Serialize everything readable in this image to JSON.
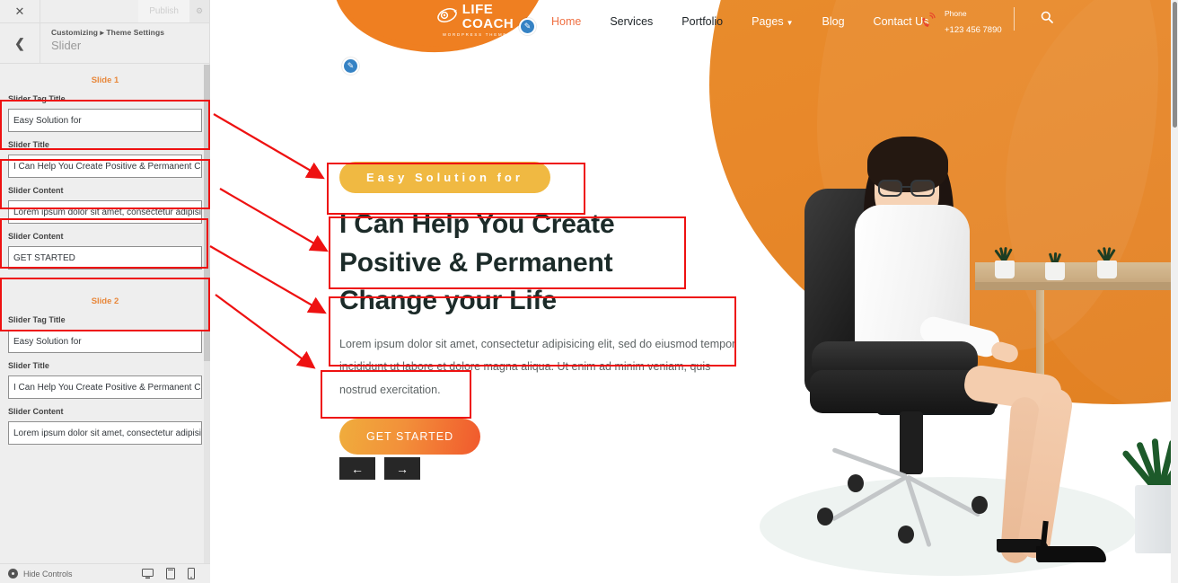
{
  "customizer": {
    "close_icon": "close-icon",
    "publish_label": "Publish",
    "publish_gear_icon": "gear-icon",
    "back_icon": "chevron-left-icon",
    "breadcrumb": "Customizing ▸ Theme Settings",
    "panel_title": "Slider",
    "footer": {
      "hide_controls_label": "Hide Controls",
      "desktop_icon": "desktop-preview-icon",
      "tablet_icon": "tablet-preview-icon",
      "mobile_icon": "mobile-preview-icon"
    },
    "slides": [
      {
        "heading": "Slide 1",
        "fields": [
          {
            "label": "Slider Tag Title",
            "value": "Easy Solution for"
          },
          {
            "label": "Slider Title",
            "value": "I Can Help You Create Positive & Permanent Change your"
          },
          {
            "label": "Slider Content",
            "value": "Lorem ipsum dolor sit amet, consectetur adipisicing elit,"
          },
          {
            "label": "Slider Content",
            "value": "GET STARTED"
          }
        ]
      },
      {
        "heading": "Slide 2",
        "fields": [
          {
            "label": "Slider Tag Title",
            "value": "Easy Solution for"
          },
          {
            "label": "Slider Title",
            "value": "I Can Help You Create Positive & Permanent Change your"
          },
          {
            "label": "Slider Content",
            "value": "Lorem ipsum dolor sit amet, consectetur adipisicing elit,"
          }
        ]
      }
    ]
  },
  "preview": {
    "logo": {
      "line1": "LIFE",
      "line2": "COACH",
      "tagline": "WORDPRESS THEME",
      "icon": "rocket-orbit-icon"
    },
    "nav": [
      {
        "label": "Home",
        "active": true
      },
      {
        "label": "Services",
        "active": false
      },
      {
        "label": "Portfolio",
        "active": false
      },
      {
        "label": "Pages",
        "active": false,
        "has_caret": true
      },
      {
        "label": "Blog",
        "active": false
      },
      {
        "label": "Contact Us",
        "active": false
      }
    ],
    "phone": {
      "icon": "phone-ringing-icon",
      "label": "Phone",
      "number": "+123 456 7890"
    },
    "search_icon": "search-icon",
    "hero": {
      "tag": "Easy Solution for",
      "title": "I Can Help You Create Positive & Permanent Change your Life",
      "paragraph": "Lorem ipsum dolor sit amet, consectetur adipisicing elit, sed do eiusmod tempor incididunt ut labore et dolore magna aliqua. Ut enim ad minim veniam, quis nostrud exercitation.",
      "cta": "GET STARTED"
    },
    "slider_nav": {
      "prev_icon": "arrow-left-icon",
      "next_icon": "arrow-right-icon",
      "prev": "←",
      "next": "→"
    },
    "edit_pencil_icon": "pencil-edit-icon"
  },
  "colors": {
    "orange": "#ef7f21",
    "orange_band": "#e8882a",
    "cream": "#fbe7c3",
    "yellow_pill": "#f0b942",
    "cta_start": "#f0ad3c",
    "cta_end": "#f1592d",
    "active_link": "#ef7043",
    "annotation_red": "#ee1111",
    "slide_label": "#e8873a",
    "heading": "#1c2b29"
  }
}
